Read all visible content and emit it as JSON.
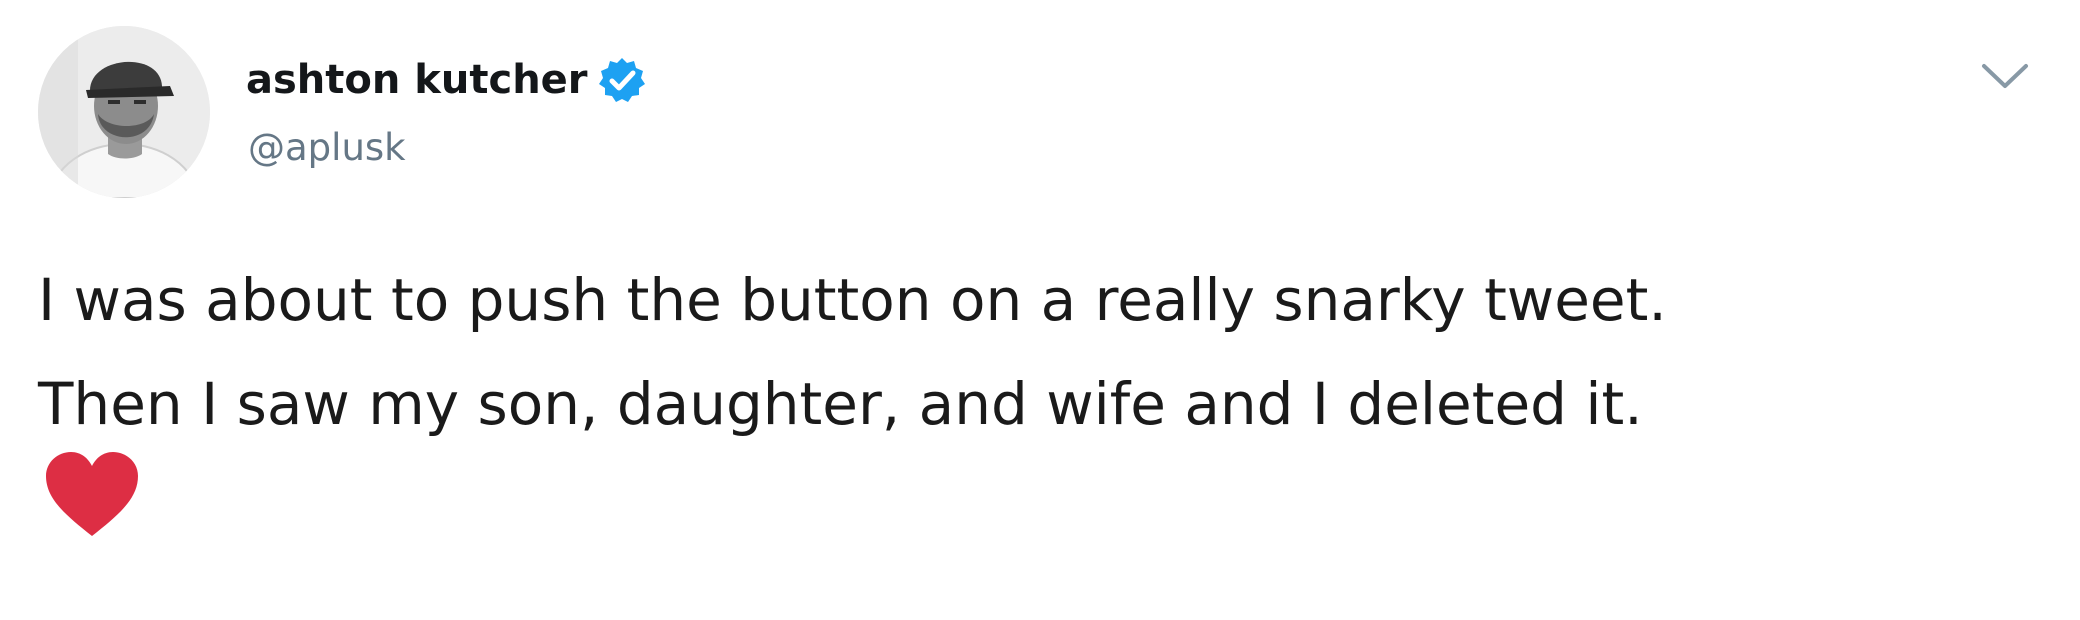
{
  "author": {
    "display_name": "ashton kutcher",
    "handle": "@aplusk",
    "verified": true,
    "avatar_icon": "profile-photo"
  },
  "tweet": {
    "lines": [
      "I was about to push the button on a really snarky tweet.",
      "Then I saw my son, daughter, and wife and I deleted it."
    ],
    "emoji": "red-heart-icon"
  },
  "colors": {
    "verified_blue": "#1da1f2",
    "heart_red": "#dd2e44",
    "handle_gray": "#657786",
    "caret_gray": "#8899a6"
  }
}
